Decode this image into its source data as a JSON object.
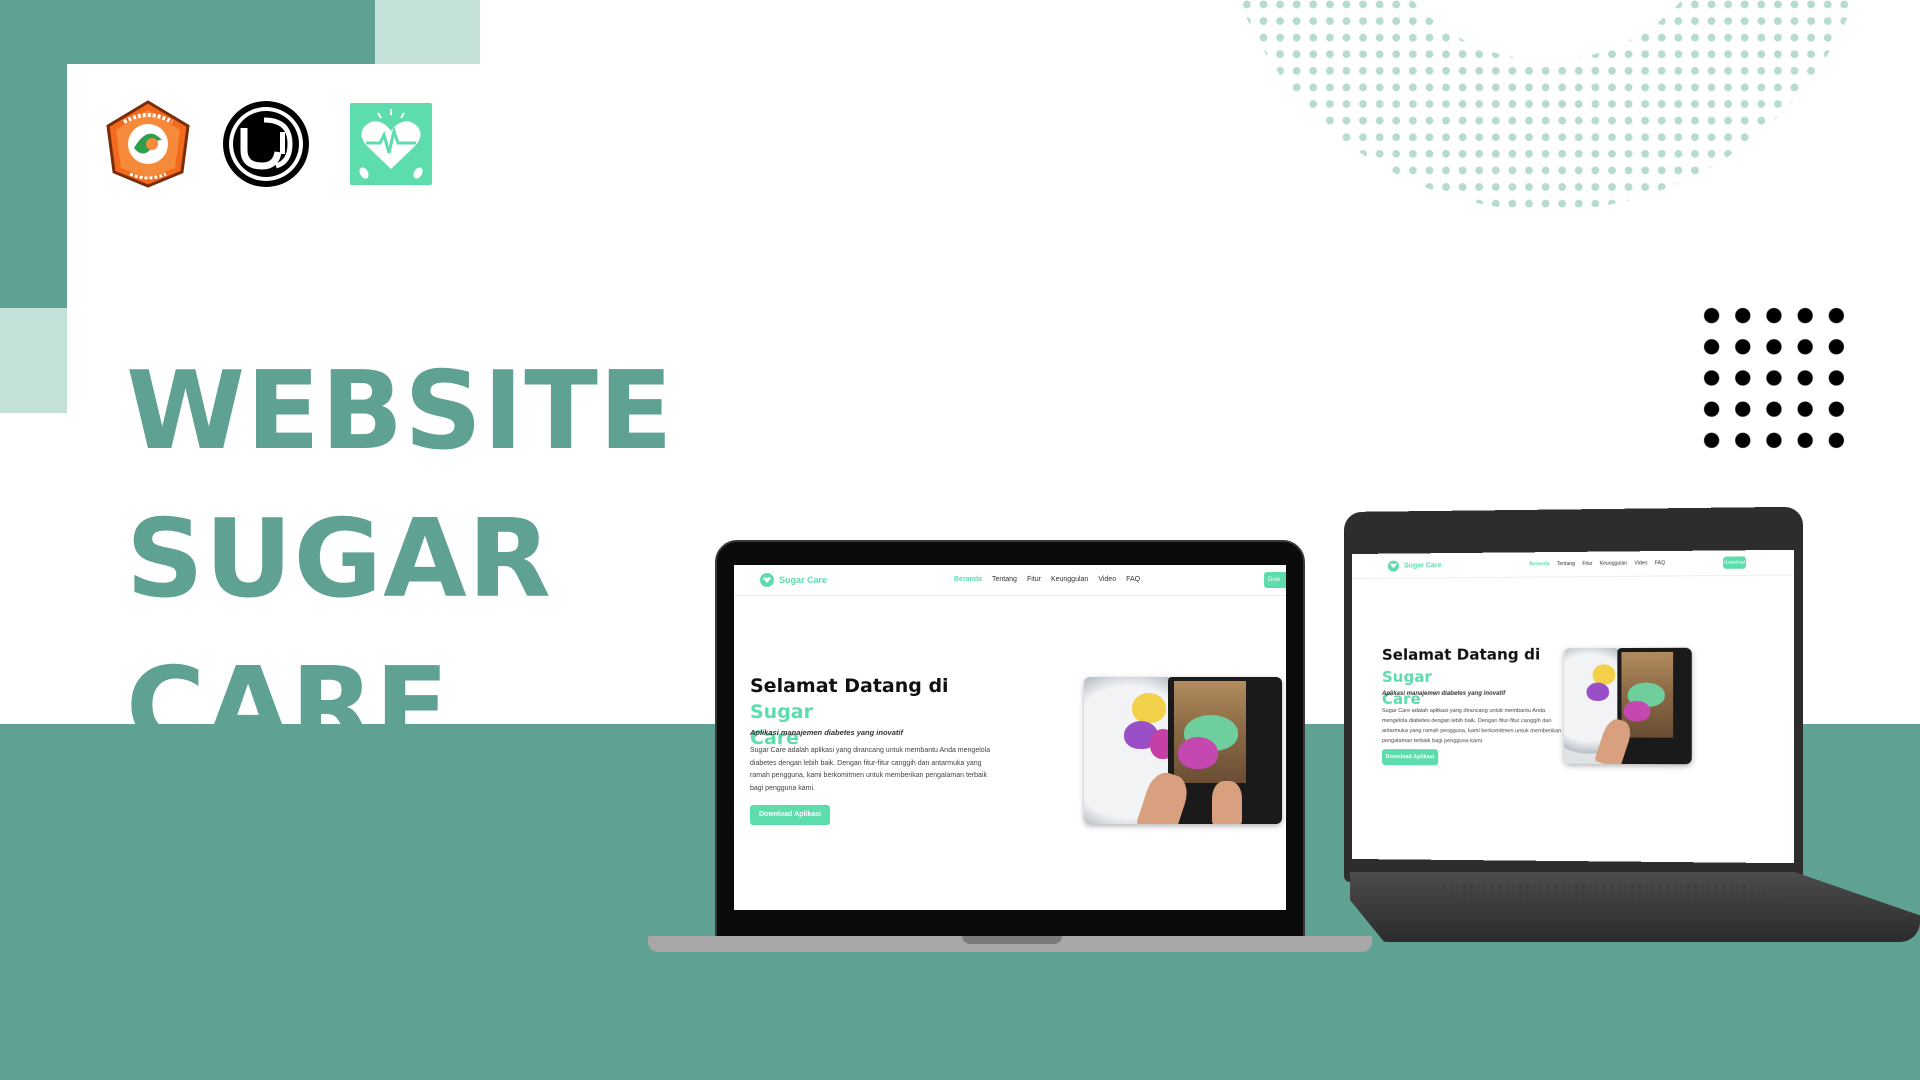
{
  "slide": {
    "title_line1": "WEBSITE SUGAR",
    "title_line2": "CARE"
  },
  "logos": {
    "pnp_icon": "politeknik-negeri-padang-logo-icon",
    "uni_icon": "university-circle-logo-icon",
    "app_icon": "heart-pulse-app-icon"
  },
  "colors": {
    "primary": "#5fa193",
    "light": "#c3e1d9",
    "accent": "#5ddcac"
  },
  "site": {
    "brand": "Sugar Care",
    "nav": [
      "Beranda",
      "Tentang",
      "Fitur",
      "Keunggulan",
      "Video",
      "FAQ"
    ],
    "nav_button": "Download",
    "nav_button_cropped": "Dow",
    "hero_title": "Selamat Datang di",
    "hero_title_highlight": "Sugar Care",
    "hero_title_highlight_1": "Sugar",
    "hero_title_highlight_2": "Care",
    "tagline": "Aplikasi manajemen diabetes yang inovatif",
    "description": "Sugar Care adalah aplikasi yang dirancang untuk membantu Anda mengelola diabetes dengan lebih baik. Dengan fitur-fitur canggih dan antarmuka yang ramah pengguna, kami berkomitmen untuk memberikan pengalaman terbaik bagi pengguna kami.",
    "cta": "Download Aplikasi"
  }
}
